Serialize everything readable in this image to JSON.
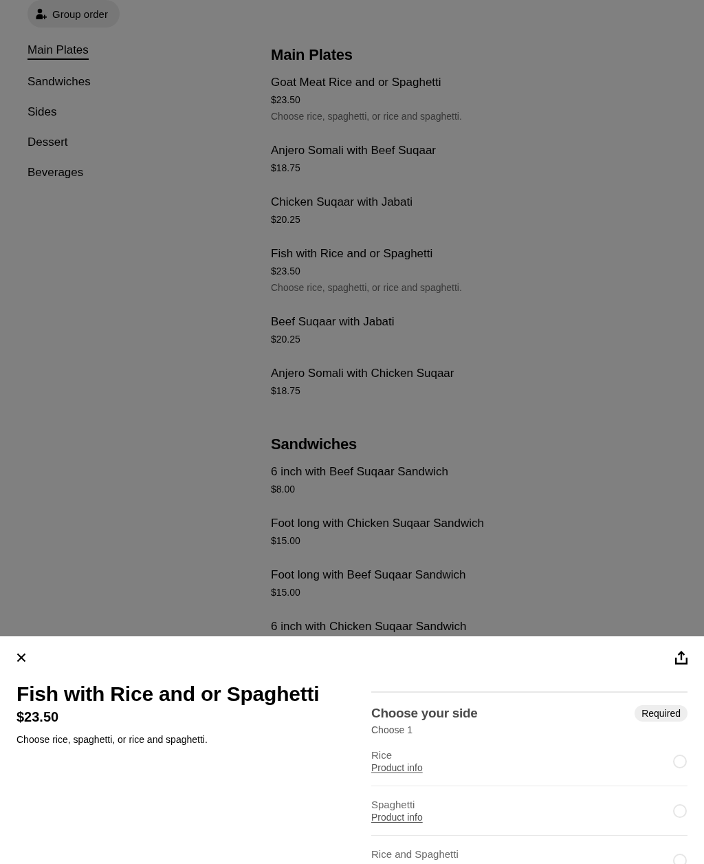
{
  "header": {
    "group_order_button": "Group order"
  },
  "sidebar": {
    "items": [
      {
        "label": "Main Plates",
        "selected": true
      },
      {
        "label": "Sandwiches",
        "selected": false
      },
      {
        "label": "Sides",
        "selected": false
      },
      {
        "label": "Dessert",
        "selected": false
      },
      {
        "label": "Beverages",
        "selected": false
      }
    ]
  },
  "menu": {
    "sections": [
      {
        "title": "Main Plates",
        "items": [
          {
            "name": "Goat Meat Rice and or Spaghetti",
            "price": "$23.50",
            "description": "Choose rice, spaghetti, or rice and spaghetti."
          },
          {
            "name": "Anjero Somali with Beef Suqaar",
            "price": "$18.75"
          },
          {
            "name": "Chicken Suqaar with Jabati",
            "price": "$20.25"
          },
          {
            "name": "Fish with Rice and or Spaghetti",
            "price": "$23.50",
            "description": "Choose rice, spaghetti, or rice and spaghetti."
          },
          {
            "name": "Beef Suqaar with Jabati",
            "price": "$20.25"
          },
          {
            "name": "Anjero Somali with Chicken Suqaar",
            "price": "$18.75"
          }
        ]
      },
      {
        "title": "Sandwiches",
        "items": [
          {
            "name": "6 inch with Beef Suqaar Sandwich",
            "price": "$8.00"
          },
          {
            "name": "Foot long with Chicken Suqaar Sandwich",
            "price": "$15.00"
          },
          {
            "name": "Foot long with Beef Suqaar Sandwich",
            "price": "$15.00"
          },
          {
            "name": "6 inch with Chicken Suqaar Sandwich"
          }
        ]
      }
    ]
  },
  "item_sheet": {
    "title": "Fish with Rice and or Spaghetti",
    "price": "$23.50",
    "description": "Choose rice, spaghetti, or rice and spaghetti.",
    "option_group": {
      "title": "Choose your side",
      "requirement": "Required",
      "hint": "Choose 1",
      "options": [
        {
          "name": "Rice",
          "link": "Product info",
          "selected": false
        },
        {
          "name": "Spaghetti",
          "link": "Product info",
          "selected": false
        },
        {
          "name": "Rice and Spaghetti",
          "selected": false
        }
      ]
    }
  }
}
